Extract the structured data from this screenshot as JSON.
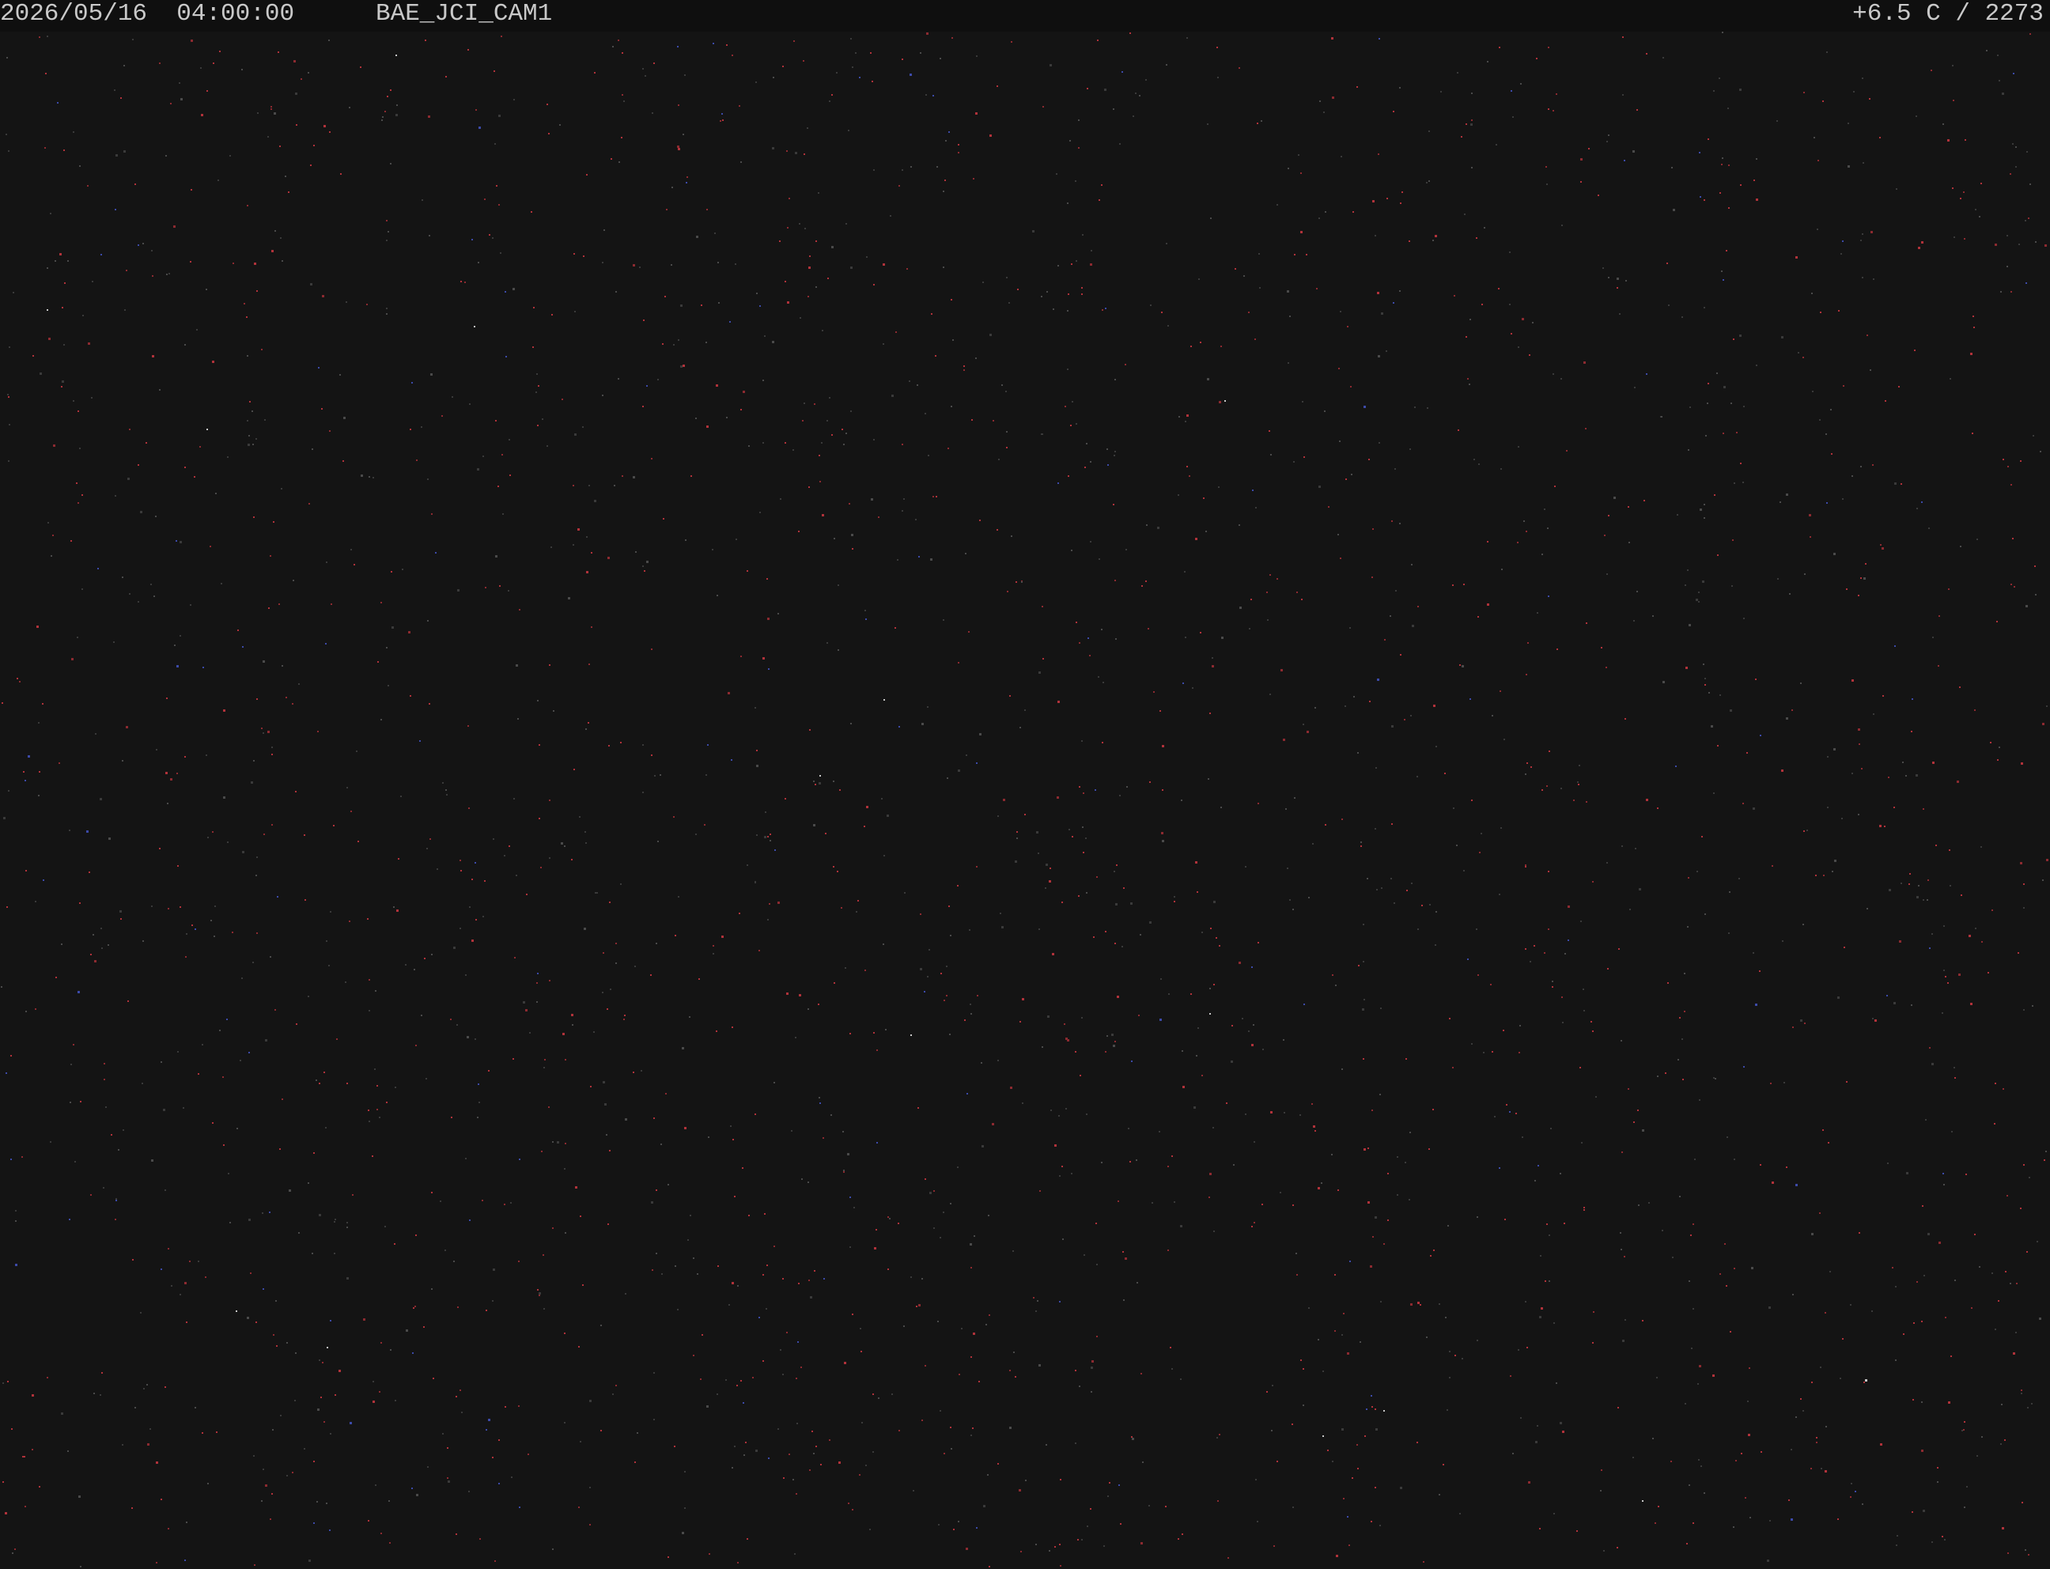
{
  "overlay": {
    "timestamp": "2026/05/16  04:00:00",
    "camera_id": "BAE_JCI_CAM1",
    "reading": "+6.5 C / 2273"
  },
  "scene": {
    "background_color": "#141414",
    "bar_color": "#0f0f0f",
    "text_color": "#c9c9c9",
    "noise_colors": [
      "#b0323a",
      "#8c2a30",
      "#3a3a3a",
      "#4a4a4a",
      "#3c4aa8",
      "#c8c8c8"
    ]
  }
}
